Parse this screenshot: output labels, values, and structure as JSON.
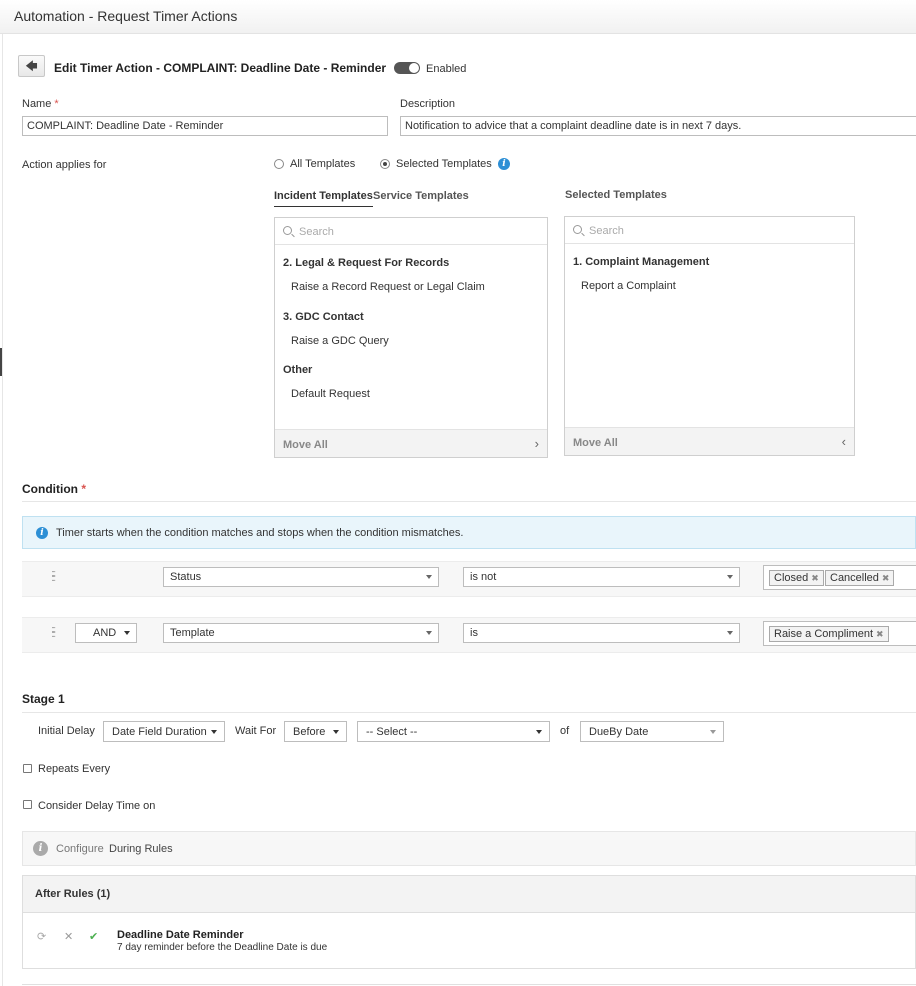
{
  "header": {
    "title": "Automation - Request Timer Actions"
  },
  "edit": {
    "back_icon": "arrow-left-icon",
    "title": "Edit Timer Action - COMPLAINT: Deadline Date - Reminder",
    "enabled_label": "Enabled",
    "enabled": true
  },
  "form": {
    "name_label": "Name",
    "required_mark": "*",
    "name_value": "COMPLAINT: Deadline Date - Reminder",
    "description_label": "Description",
    "description_value": "Notification to advice that a complaint deadline date is in next 7 days.",
    "applies_label": "Action applies for",
    "radio_all": "All Templates",
    "radio_selected": "Selected Templates",
    "radio_selected_checked": true
  },
  "templates": {
    "tabs": [
      "Incident Templates",
      "Service Templates"
    ],
    "selected_title": "Selected Templates",
    "search_placeholder": "Search",
    "available": [
      {
        "group": "2. Legal & Request For Records",
        "items": [
          "Raise a Record Request or Legal Claim"
        ]
      },
      {
        "group": "3. GDC Contact",
        "items": [
          "Raise a GDC Query"
        ]
      },
      {
        "group": "Other",
        "items": [
          "Default Request"
        ]
      }
    ],
    "selected": [
      {
        "group": "1. Complaint Management",
        "items": [
          "Report a Complaint"
        ]
      }
    ],
    "move_all": "Move All"
  },
  "condition": {
    "title": "Condition",
    "info": "Timer starts when the condition matches and stops when the condition mismatches.",
    "rows": [
      {
        "connector": "",
        "field": "Status",
        "operator": "is not",
        "values": [
          "Closed",
          "Cancelled"
        ]
      },
      {
        "connector": "AND",
        "field": "Template",
        "operator": "is",
        "values": [
          "Raise a Compliment"
        ]
      }
    ]
  },
  "stage": {
    "title": "Stage 1",
    "initial_delay_label": "Initial Delay",
    "initial_delay_value": "Date Field Duration",
    "wait_for_label": "Wait For",
    "wait_for_value": "Before",
    "select_value": "-- Select --",
    "of_label": "of",
    "date_field_value": "DueBy Date",
    "repeats_label": "Repeats Every",
    "consider_label": "Consider Delay Time on",
    "configure_label": "Configure",
    "during_rules_label": "During Rules",
    "after_rules_title": "After Rules (1)",
    "rules": [
      {
        "name": "Deadline Date Reminder",
        "description": "7 day reminder before the Deadline Date is due"
      }
    ]
  }
}
